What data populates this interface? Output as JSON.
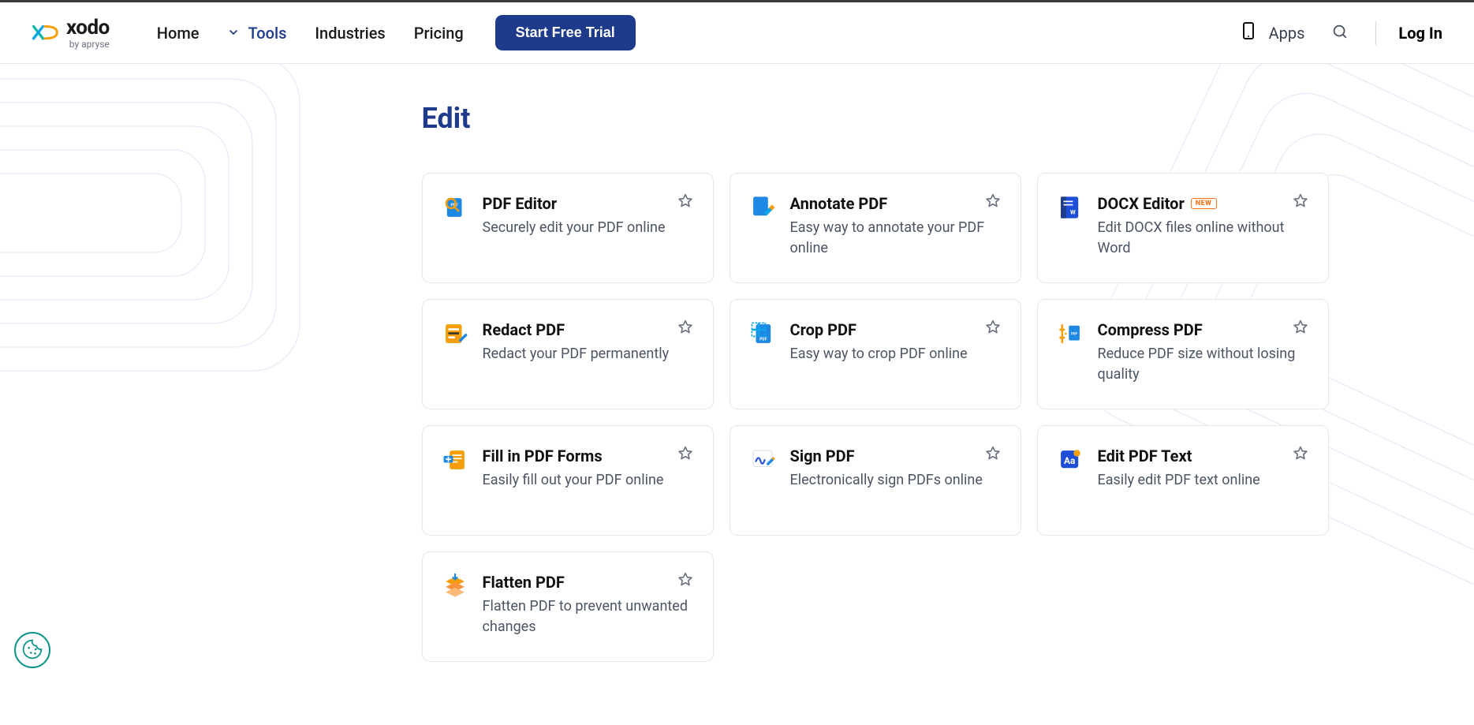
{
  "brand": {
    "name": "xodo",
    "byline": "by apryse"
  },
  "nav": {
    "home": "Home",
    "tools": "Tools",
    "industries": "Industries",
    "pricing": "Pricing",
    "cta": "Start Free Trial",
    "apps": "Apps",
    "login": "Log In"
  },
  "section": {
    "title": "Edit"
  },
  "badge_new": "NEW",
  "tools": [
    {
      "id": "pdf-editor",
      "title": "PDF Editor",
      "desc": "Securely edit your PDF online",
      "icon": "search-pdf",
      "badge": null
    },
    {
      "id": "annotate-pdf",
      "title": "Annotate PDF",
      "desc": "Easy way to annotate your PDF online",
      "icon": "annotate",
      "badge": null
    },
    {
      "id": "docx-editor",
      "title": "DOCX Editor",
      "desc": "Edit DOCX files online without Word",
      "icon": "docx",
      "badge": "new"
    },
    {
      "id": "redact-pdf",
      "title": "Redact PDF",
      "desc": "Redact your PDF permanently",
      "icon": "redact",
      "badge": null
    },
    {
      "id": "crop-pdf",
      "title": "Crop PDF",
      "desc": "Easy way to crop PDF online",
      "icon": "crop",
      "badge": null
    },
    {
      "id": "compress-pdf",
      "title": "Compress PDF",
      "desc": "Reduce PDF size without losing quality",
      "icon": "compress",
      "badge": null
    },
    {
      "id": "fill-forms",
      "title": "Fill in PDF Forms",
      "desc": "Easily fill out your PDF online",
      "icon": "forms",
      "badge": null
    },
    {
      "id": "sign-pdf",
      "title": "Sign PDF",
      "desc": "Electronically sign PDFs online",
      "icon": "sign",
      "badge": null
    },
    {
      "id": "edit-text",
      "title": "Edit PDF Text",
      "desc": "Easily edit PDF text online",
      "icon": "text",
      "badge": null
    },
    {
      "id": "flatten-pdf",
      "title": "Flatten PDF",
      "desc": "Flatten PDF to prevent unwanted changes",
      "icon": "flatten",
      "badge": null
    }
  ]
}
